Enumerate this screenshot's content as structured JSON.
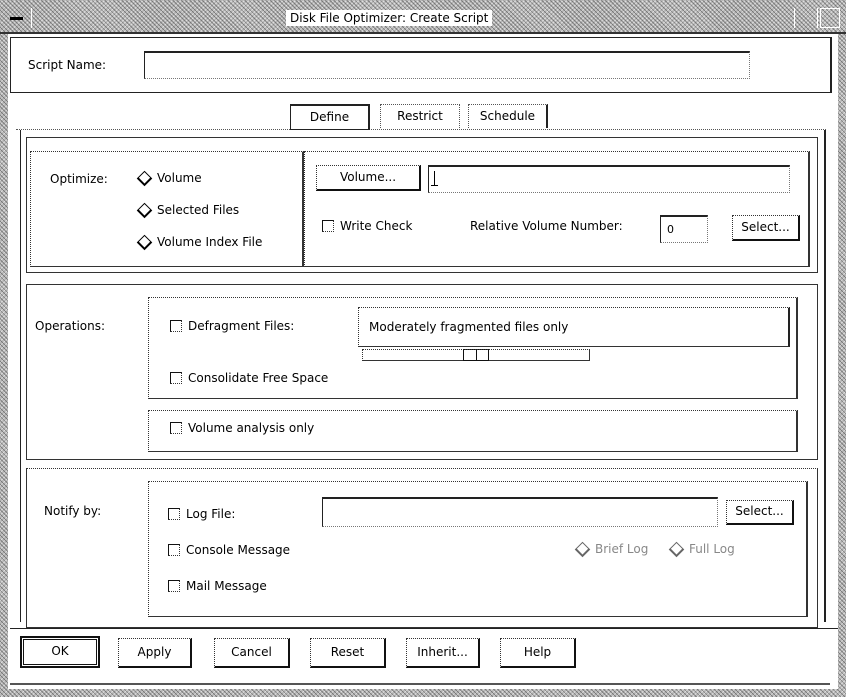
{
  "window": {
    "title": "Disk File Optimizer: Create Script"
  },
  "script_name": {
    "label": "Script Name:",
    "value": ""
  },
  "tabs": [
    {
      "label": "Define",
      "active": true
    },
    {
      "label": "Restrict",
      "active": false
    },
    {
      "label": "Schedule",
      "active": false
    }
  ],
  "optimize": {
    "label": "Optimize:",
    "options": [
      {
        "label": "Volume",
        "selected": false
      },
      {
        "label": "Selected Files",
        "selected": false
      },
      {
        "label": "Volume Index File",
        "selected": false
      }
    ],
    "volume_button": "Volume...",
    "volume_value": "",
    "write_check": {
      "label": "Write Check",
      "checked": false
    },
    "relative_volume_label": "Relative Volume Number:",
    "relative_volume_value": "0",
    "select_button": "Select..."
  },
  "operations": {
    "label": "Operations:",
    "defragment": {
      "label": "Defragment Files:",
      "checked": false
    },
    "defrag_level": "Moderately fragmented files only",
    "defrag_slider_fraction": 0.5,
    "consolidate": {
      "label": "Consolidate Free Space",
      "checked": false
    },
    "analysis_only": {
      "label": "Volume analysis only",
      "checked": false
    }
  },
  "notify": {
    "label": "Notify by:",
    "log_file": {
      "label": "Log File:",
      "checked": false,
      "value": ""
    },
    "select_button": "Select...",
    "console_message": {
      "label": "Console Message",
      "checked": false
    },
    "brief_log": {
      "label": "Brief Log",
      "enabled": false
    },
    "full_log": {
      "label": "Full Log",
      "enabled": false
    },
    "mail_message": {
      "label": "Mail Message",
      "checked": false
    }
  },
  "buttons": {
    "ok": "OK",
    "apply": "Apply",
    "cancel": "Cancel",
    "reset": "Reset",
    "inherit": "Inherit...",
    "help": "Help"
  }
}
